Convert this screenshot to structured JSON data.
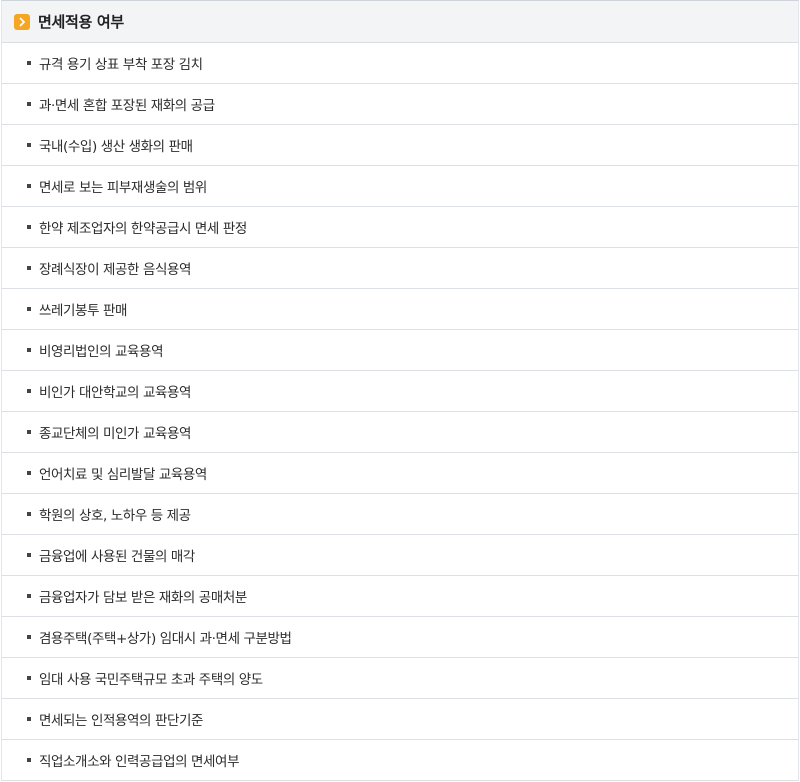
{
  "header": {
    "title": "면세적용 여부",
    "icon": "chevron-right-icon",
    "icon_color": "#f5a623"
  },
  "items": [
    {
      "label": "규격 용기 상표 부착 포장 김치"
    },
    {
      "label": "과·면세 혼합 포장된 재화의 공급"
    },
    {
      "label": "국내(수입) 생산 생화의 판매"
    },
    {
      "label": "면세로 보는 피부재생술의 범위"
    },
    {
      "label": "한약 제조업자의 한약공급시 면세 판정"
    },
    {
      "label": "장례식장이 제공한 음식용역"
    },
    {
      "label": "쓰레기봉투 판매"
    },
    {
      "label": "비영리법인의 교육용역"
    },
    {
      "label": "비인가 대안학교의 교육용역"
    },
    {
      "label": "종교단체의 미인가 교육용역"
    },
    {
      "label": "언어치료 및 심리발달 교육용역"
    },
    {
      "label": "학원의 상호, 노하우 등 제공"
    },
    {
      "label": "금융업에 사용된 건물의 매각"
    },
    {
      "label": "금융업자가 담보 받은 재화의 공매처분"
    },
    {
      "label": "겸용주택(주택+상가) 임대시 과·면세 구분방법"
    },
    {
      "label": "임대 사용 국민주택규모 초과 주택의 양도"
    },
    {
      "label": "면세되는 인적용역의 판단기준"
    },
    {
      "label": "직업소개소와 인력공급업의 면세여부"
    }
  ]
}
